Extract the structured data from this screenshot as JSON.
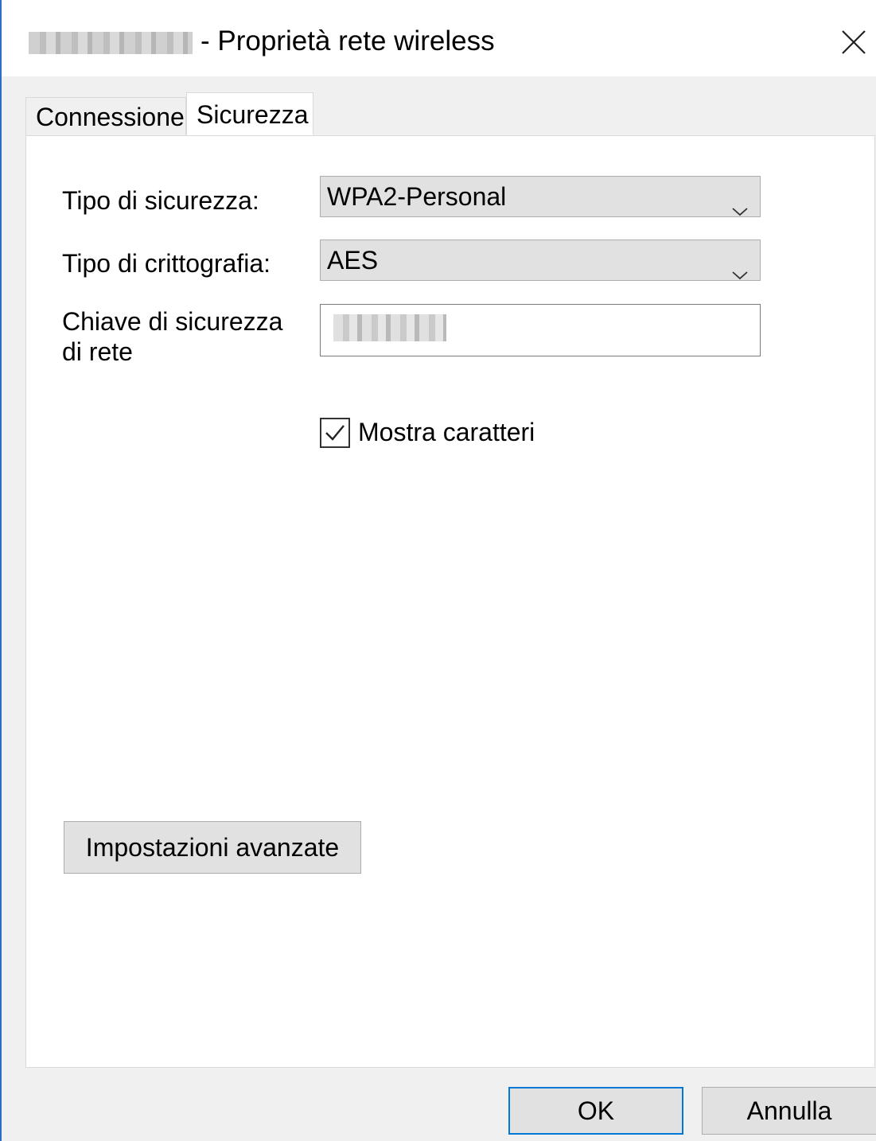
{
  "window": {
    "title": "- Proprietà rete wireless",
    "close_icon": "close-icon"
  },
  "tabs": [
    {
      "label": "Connessione",
      "active": false
    },
    {
      "label": "Sicurezza",
      "active": true
    }
  ],
  "security": {
    "type_label": "Tipo di sicurezza:",
    "type_value": "WPA2-Personal",
    "encryption_label": "Tipo di crittografia:",
    "encryption_value": "AES",
    "key_label": "Chiave di sicurezza di rete",
    "show_chars_label": "Mostra caratteri",
    "show_chars_checked": true
  },
  "buttons": {
    "advanced": "Impostazioni avanzate",
    "ok": "OK",
    "cancel": "Annulla"
  },
  "colors": {
    "focus_border": "#0078d7",
    "window_border": "#2b6fc0"
  }
}
